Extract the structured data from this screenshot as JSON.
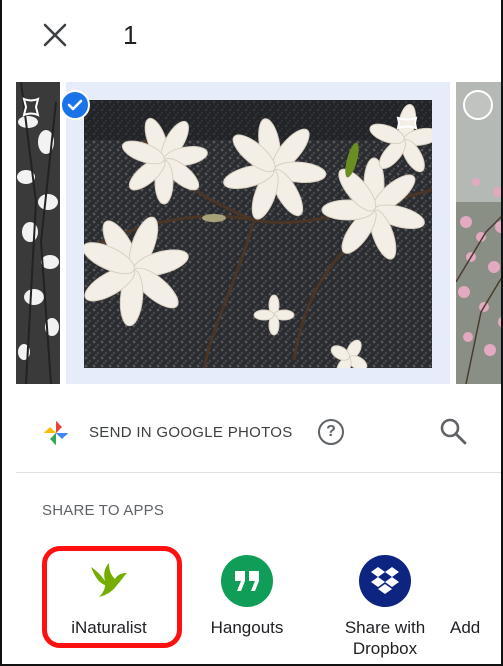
{
  "header": {
    "close_label": "Close",
    "selected_count": "1"
  },
  "photos": {
    "items": [
      {
        "position": "left",
        "selected": false
      },
      {
        "position": "center",
        "selected": true
      },
      {
        "position": "right",
        "selected": false
      }
    ]
  },
  "google_photos": {
    "label": "SEND IN GOOGLE PHOTOS",
    "help_glyph": "?"
  },
  "share": {
    "title": "SHARE TO APPS",
    "apps": [
      {
        "label": "iNaturalist",
        "icon": "inaturalist-bird-icon",
        "color": "#74ac00"
      },
      {
        "label": "Hangouts",
        "icon": "hangouts-quote-icon",
        "color": "#0f9d58"
      },
      {
        "label": "Share with Dropbox",
        "icon": "dropbox-icon",
        "color": "#0d2481"
      },
      {
        "label": "Add",
        "icon": "",
        "color": ""
      }
    ]
  },
  "colors": {
    "accent": "#1a73e8",
    "highlight": "#ff1010",
    "selection_bg": "#e6ecfa"
  }
}
